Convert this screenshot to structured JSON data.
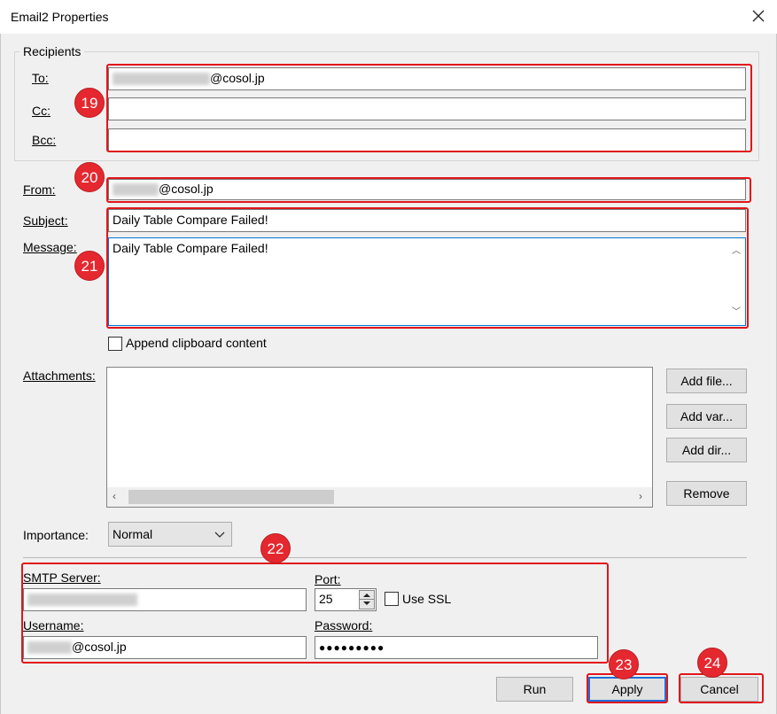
{
  "window": {
    "title": "Email2 Properties",
    "close_glyph": "✕"
  },
  "recipients": {
    "group_label": "Recipients",
    "to_label": "To:",
    "to_value_suffix": "@cosol.jp",
    "cc_label": "Cc:",
    "cc_value": "",
    "bcc_label": "Bcc:",
    "bcc_value": ""
  },
  "from": {
    "label": "From:",
    "value_suffix": "@cosol.jp"
  },
  "subject": {
    "label": "Subject:",
    "value": "Daily Table Compare Failed!"
  },
  "message": {
    "label": "Message:",
    "value": "Daily Table Compare Failed!"
  },
  "append_clipboard": {
    "label": "Append clipboard content",
    "checked": false
  },
  "attachments": {
    "label": "Attachments:",
    "add_file": "Add file...",
    "add_var": "Add var...",
    "add_dir": "Add dir...",
    "remove": "Remove"
  },
  "importance": {
    "label": "Importance:",
    "value": "Normal"
  },
  "smtp": {
    "server_label": "SMTP Server:",
    "port_label": "Port:",
    "port_value": "25",
    "use_ssl_label": "Use SSL",
    "use_ssl_checked": false,
    "username_label": "Username:",
    "username_suffix": "@cosol.jp",
    "password_label": "Password:",
    "password_value": "●●●●●●●●●"
  },
  "buttons": {
    "run": "Run",
    "apply": "Apply",
    "cancel": "Cancel"
  },
  "badges": [
    "19",
    "20",
    "21",
    "22",
    "23",
    "24"
  ],
  "colors": {
    "annotation_red": "#e0161b",
    "badge_red": "#e5282f",
    "apply_focus": "#1e6fd9"
  }
}
